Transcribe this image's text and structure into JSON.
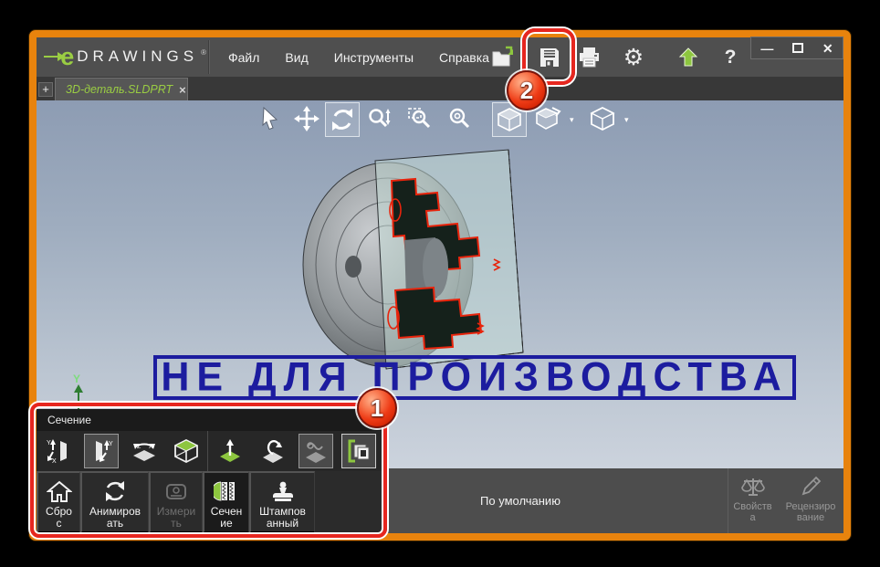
{
  "logo": {
    "e": "e",
    "name": "DRAWINGS",
    "reg": "®"
  },
  "menubar": {
    "items": [
      {
        "label": "Файл"
      },
      {
        "label": "Вид"
      },
      {
        "label": "Инструменты"
      },
      {
        "label": "Справка"
      }
    ]
  },
  "toolbar": {
    "icons": [
      "open-icon",
      "save-icon",
      "print-icon",
      "settings-icon",
      "publish-icon",
      "help-icon"
    ],
    "help_glyph": "?",
    "window_controls": {
      "minimize": "—",
      "close": "✕"
    }
  },
  "tabbar": {
    "add_label": "+",
    "tab_label": "3D-деталь.SLDPRT",
    "close_label": "×"
  },
  "view_toolbar": {
    "tools": [
      {
        "name": "select"
      },
      {
        "name": "pan"
      },
      {
        "name": "rotate",
        "selected": true
      },
      {
        "name": "zoom"
      },
      {
        "name": "zoom-area"
      },
      {
        "name": "zoom-fit"
      },
      {
        "name": "shaded-view",
        "selected": true
      },
      {
        "name": "view-orientation",
        "has_dropdown": true
      },
      {
        "name": "display-style",
        "has_dropdown": true
      }
    ],
    "caret": "▾"
  },
  "viewport": {
    "watermark": "НЕ ДЛЯ ПРОИЗВОДСТВА",
    "axis_label": "Y"
  },
  "section_panel": {
    "title": "Сечение",
    "plane_tools": [
      "section-plane-xy",
      "section-plane-zy-selected",
      "section-plane-zx",
      "show-section-cube",
      "offset-plane",
      "rotate-plane",
      "drag-section-disabled",
      "show-cut-caps-selected"
    ],
    "buttons": [
      {
        "label": "Сброс"
      },
      {
        "label": "Анимировать"
      },
      {
        "label": "Измерить",
        "disabled": true
      },
      {
        "label": "Сечение",
        "active": true
      },
      {
        "label": "Штампованный"
      }
    ]
  },
  "statusbar": {
    "config_label": "По умолчанию",
    "buttons": [
      {
        "label": "Свойства"
      },
      {
        "label": "Рецензирование"
      }
    ]
  },
  "callouts": {
    "one": "1",
    "two": "2"
  },
  "colors": {
    "accent_green": "#9acd43",
    "callout_red": "#e6261f",
    "watermark_blue": "#1c1c9f",
    "frame_orange": "#e8830d"
  }
}
